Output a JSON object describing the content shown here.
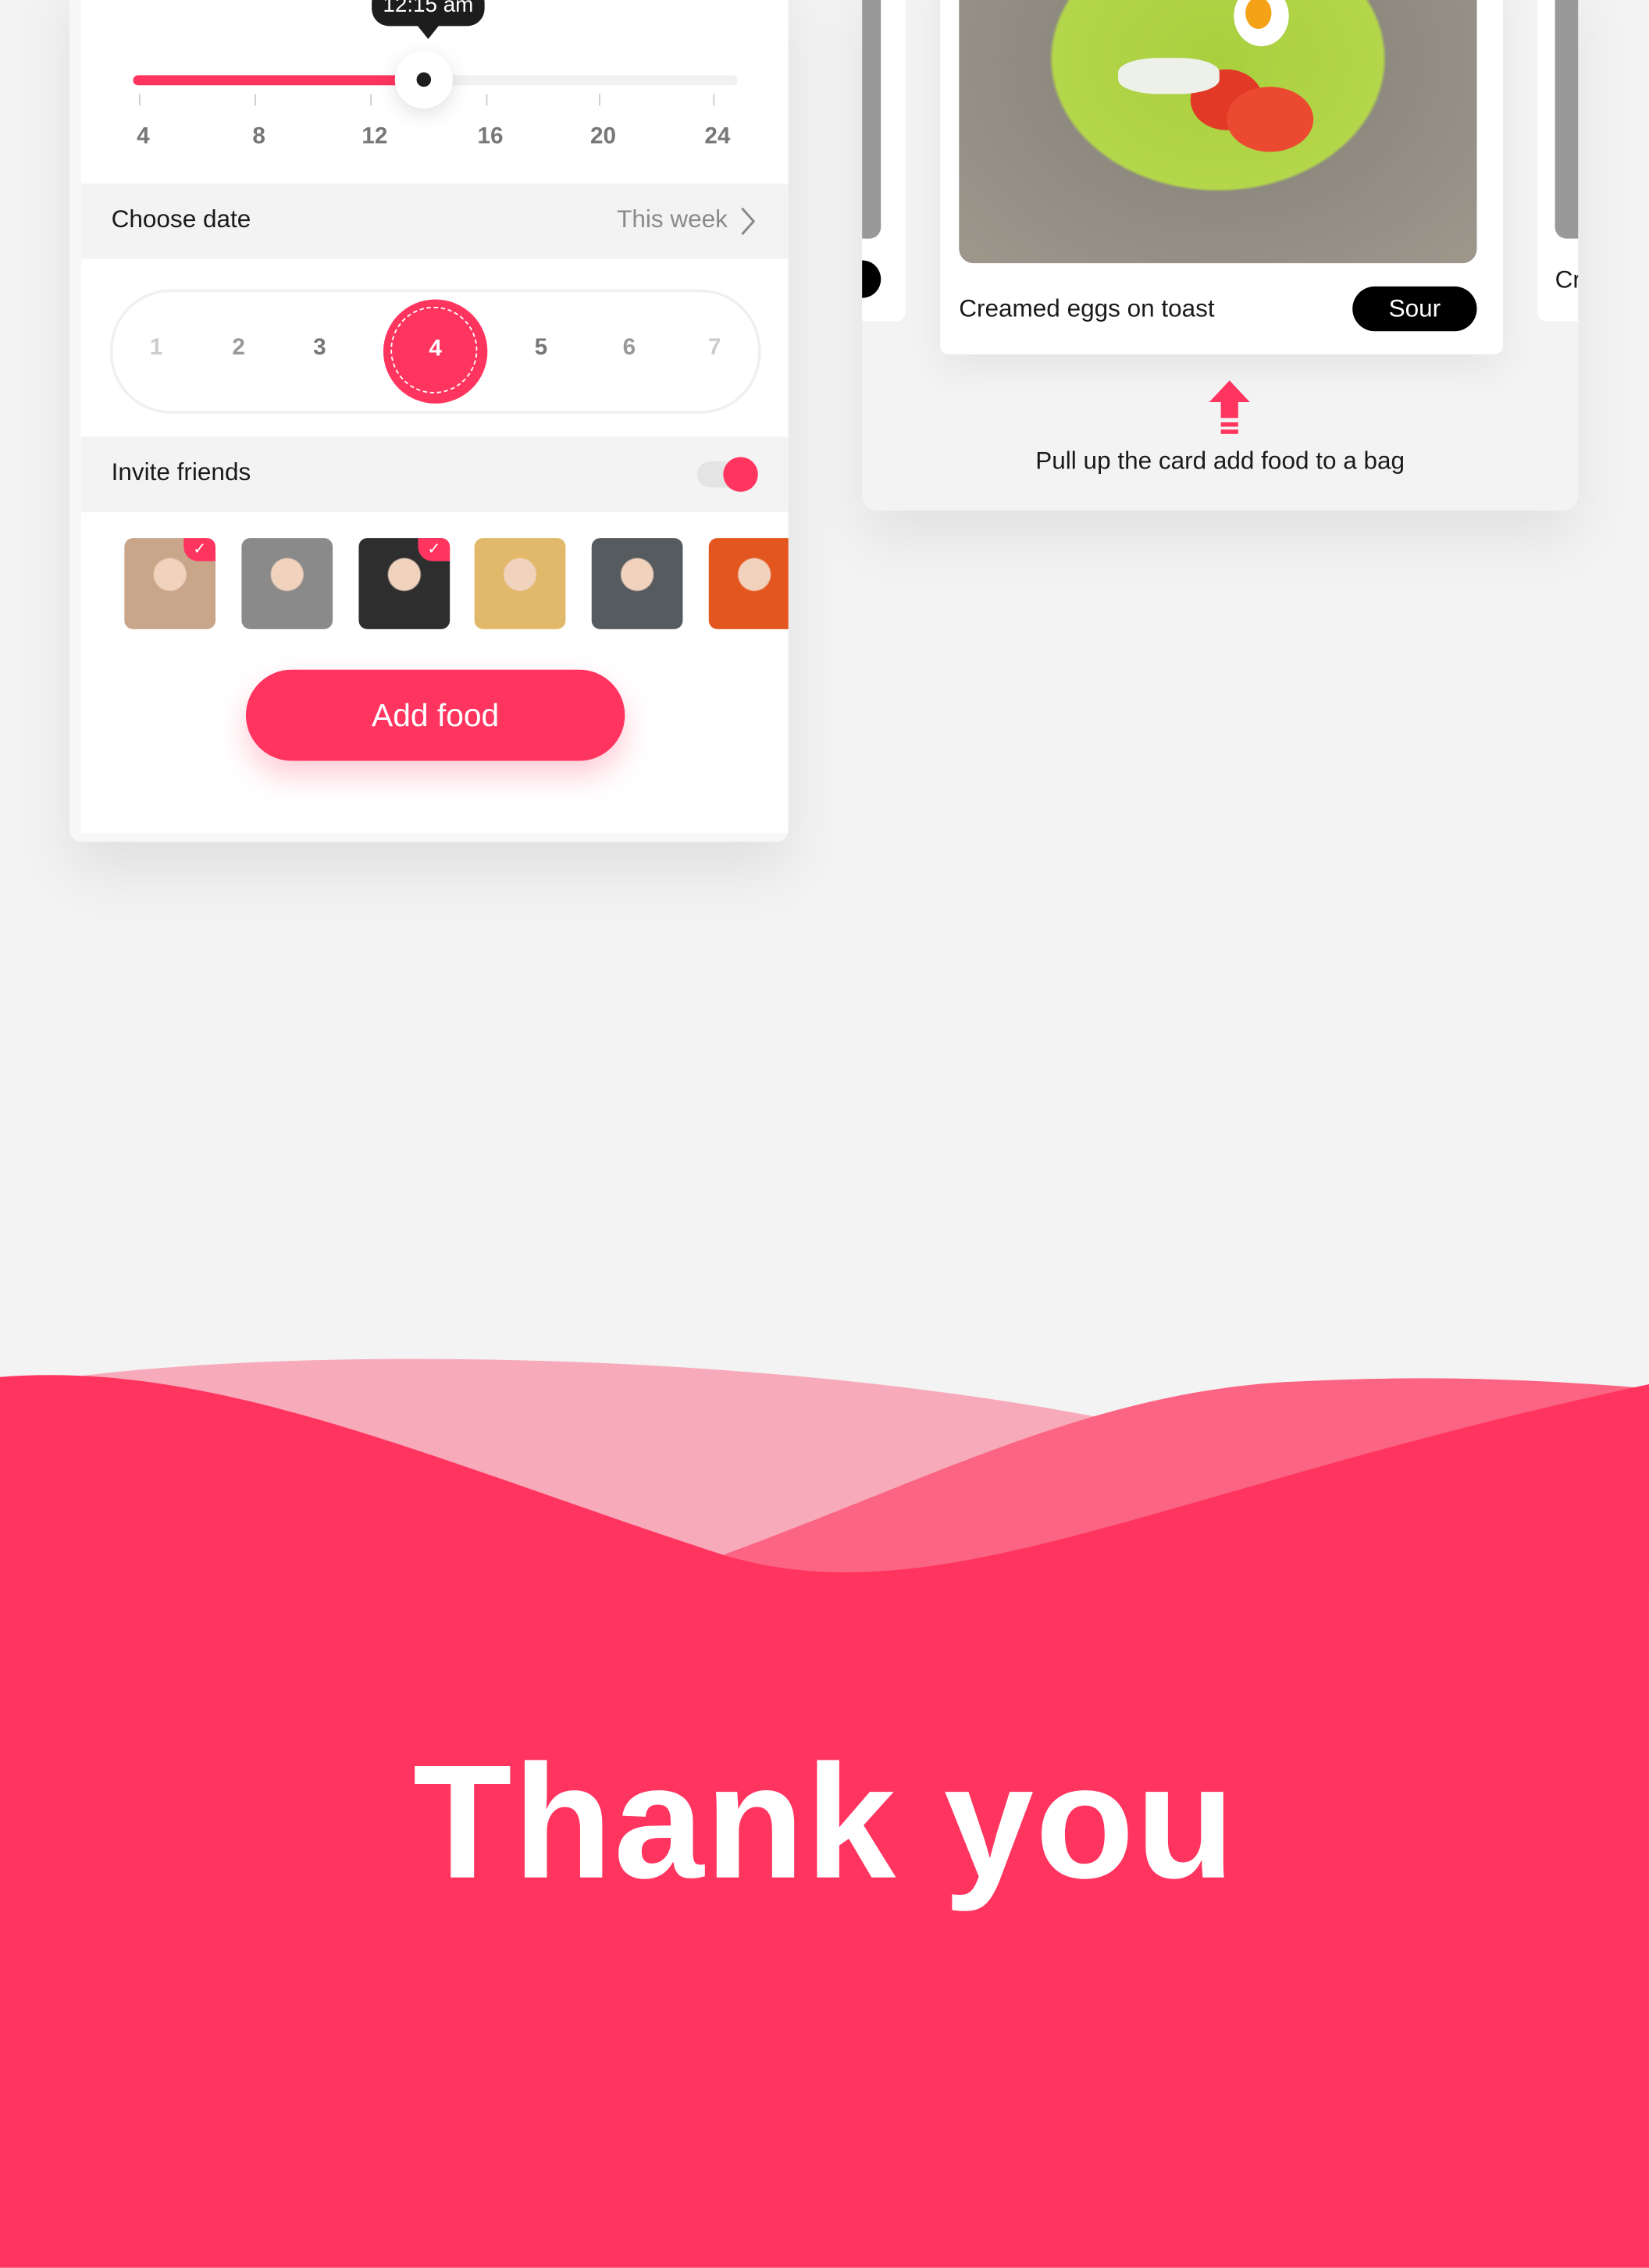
{
  "slider": {
    "tooltip": "12:15 am",
    "value_fraction": 0.48,
    "ticks": [
      "4",
      "8",
      "12",
      "16",
      "20",
      "24"
    ]
  },
  "date": {
    "label": "Choose date",
    "value": "This week",
    "days": [
      "1",
      "2",
      "3",
      "4",
      "5",
      "6",
      "7"
    ],
    "selected": "4"
  },
  "invite": {
    "label": "Invite friends",
    "toggle_on": true,
    "friends": [
      {
        "selected": true,
        "color": "#c9a58a"
      },
      {
        "selected": false,
        "color": "#8a8a8a"
      },
      {
        "selected": true,
        "color": "#2e2e2e"
      },
      {
        "selected": false,
        "color": "#e2b86a"
      },
      {
        "selected": false,
        "color": "#555b5e"
      },
      {
        "selected": false,
        "color": "#e4561f"
      }
    ],
    "check": "✓"
  },
  "add_button": "Add food",
  "cards": {
    "center": {
      "title": "Creamed eggs on toast",
      "tag": "Sour"
    },
    "right_partial": "Cr"
  },
  "hint": "Pull up the card add food to a bag",
  "thanks": "Thank you",
  "colors": {
    "accent": "#ff3560",
    "background": "#f3f3f3",
    "wave_light": "#f7aaba",
    "wave_mid": "#fb6482"
  }
}
